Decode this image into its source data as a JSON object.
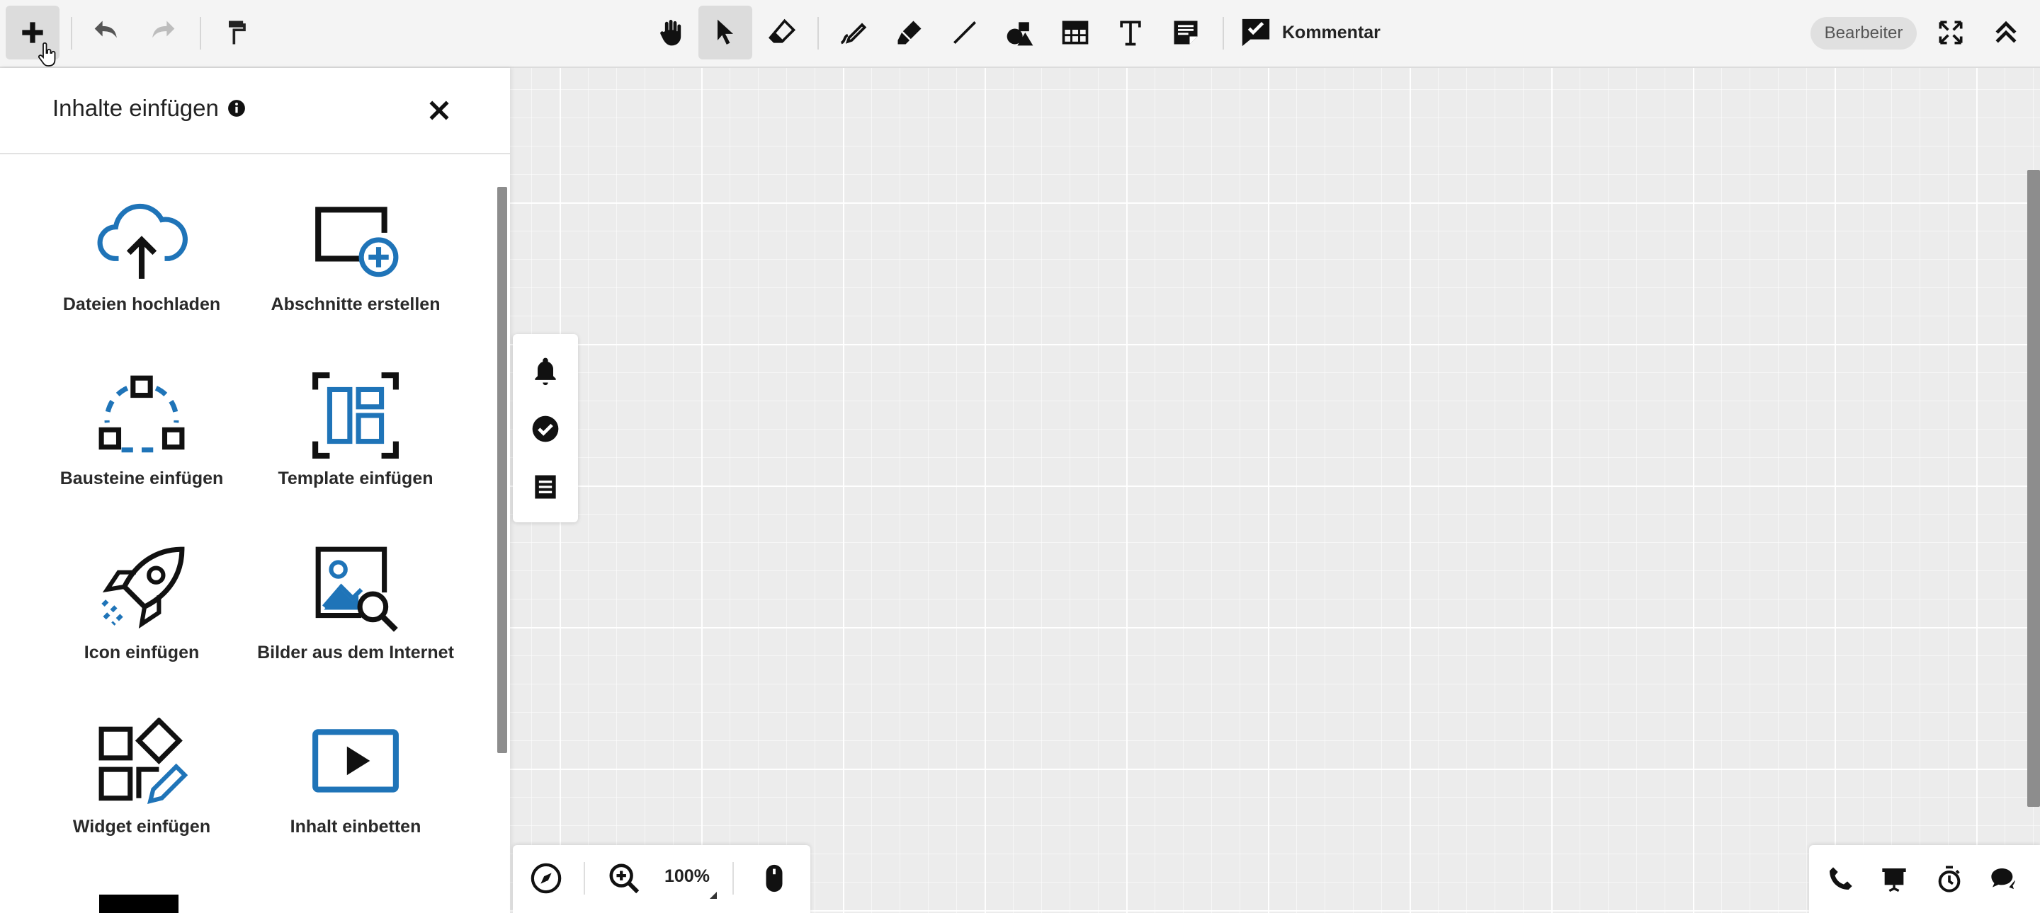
{
  "toolbar": {
    "comment_label": "Kommentar",
    "role_badge": "Bearbeiter"
  },
  "panel": {
    "title": "Inhalte einfügen",
    "items": [
      {
        "label": "Dateien hochladen",
        "icon": "cloud-upload-icon"
      },
      {
        "label": "Abschnitte erstellen",
        "icon": "add-section-icon"
      },
      {
        "label": "Bausteine einfügen",
        "icon": "building-blocks-icon"
      },
      {
        "label": "Template einfügen",
        "icon": "template-icon"
      },
      {
        "label": "Icon einfügen",
        "icon": "rocket-icon"
      },
      {
        "label": "Bilder aus dem Internet",
        "icon": "image-search-icon"
      },
      {
        "label": "Widget einfügen",
        "icon": "widget-icon"
      },
      {
        "label": "Inhalt einbetten",
        "icon": "embed-video-icon"
      }
    ]
  },
  "zoom": {
    "value": "100%"
  },
  "colors": {
    "accent_blue": "#1f74b8",
    "icon_dark": "#111111"
  }
}
